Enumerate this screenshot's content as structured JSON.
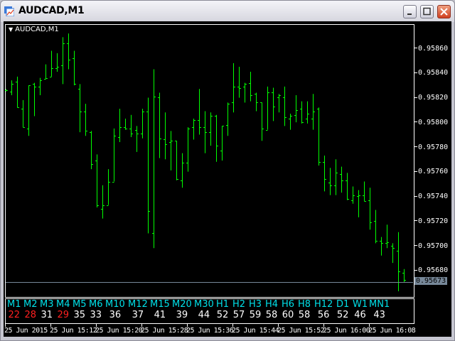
{
  "window": {
    "title": "AUDCAD,M1"
  },
  "chart_label": "AUDCAD,M1",
  "chart_data": {
    "type": "ohlc",
    "symbol": "AUDCAD",
    "timeframe": "M1",
    "ylim": [
      0.9566,
      0.9588
    ],
    "price_labels": [
      "0.95860",
      "0.95840",
      "0.95820",
      "0.95800",
      "0.95780",
      "0.95760",
      "0.95740",
      "0.95720",
      "0.95700",
      "0.95680"
    ],
    "current_price": "0.95673",
    "time_labels": [
      "25 Jun 2015",
      "25 Jun 15:12",
      "25 Jun 15:20",
      "25 Jun 15:28",
      "25 Jun 15:36",
      "25 Jun 15:44",
      "25 Jun 15:52",
      "25 Jun 16:00",
      "25 Jun 16:08"
    ],
    "bar_color": "#00ff00",
    "bars_ohlc": [
      [
        0.95827,
        0.95828,
        0.95826,
        0.95827
      ],
      [
        0.95826,
        0.95835,
        0.95823,
        0.95832
      ],
      [
        0.95834,
        0.95838,
        0.95813,
        0.95813
      ],
      [
        0.95812,
        0.95819,
        0.95797,
        0.95797
      ],
      [
        0.95796,
        0.95831,
        0.9579,
        0.95831
      ],
      [
        0.95832,
        0.95833,
        0.95806,
        0.9583
      ],
      [
        0.9583,
        0.95837,
        0.95823,
        0.95835
      ],
      [
        0.95836,
        0.95848,
        0.95836,
        0.95837
      ],
      [
        0.95838,
        0.95859,
        0.95838,
        0.95845
      ],
      [
        0.95845,
        0.95857,
        0.95842,
        0.95846
      ],
      [
        0.95847,
        0.9587,
        0.95832,
        0.95865
      ],
      [
        0.95865,
        0.95873,
        0.95844,
        0.95852
      ],
      [
        0.95853,
        0.95859,
        0.95831,
        0.95832
      ],
      [
        0.95828,
        0.95832,
        0.95793,
        0.9581
      ],
      [
        0.9581,
        0.95816,
        0.9579,
        0.95794
      ],
      [
        0.95793,
        0.95794,
        0.95763,
        0.95767
      ],
      [
        0.9577,
        0.95775,
        0.95732,
        0.95734
      ],
      [
        0.95731,
        0.9575,
        0.95723,
        0.95734
      ],
      [
        0.95734,
        0.95763,
        0.95734,
        0.95753
      ],
      [
        0.95753,
        0.95796,
        0.95753,
        0.9579
      ],
      [
        0.95789,
        0.95812,
        0.95785,
        0.95797
      ],
      [
        0.95797,
        0.95804,
        0.95795,
        0.95796
      ],
      [
        0.95796,
        0.95807,
        0.95789,
        0.95792
      ],
      [
        0.95795,
        0.95798,
        0.95777,
        0.95792
      ],
      [
        0.95792,
        0.95812,
        0.95788,
        0.9581
      ],
      [
        0.9581,
        0.95821,
        0.95711,
        0.95729
      ],
      [
        0.95711,
        0.95844,
        0.95699,
        0.95822
      ],
      [
        0.95821,
        0.95825,
        0.95772,
        0.95788
      ],
      [
        0.95787,
        0.95809,
        0.95771,
        0.95783
      ],
      [
        0.95785,
        0.95794,
        0.95762,
        0.95786
      ],
      [
        0.95786,
        0.95786,
        0.95754,
        0.95755
      ],
      [
        0.95754,
        0.95776,
        0.95748,
        0.95768
      ],
      [
        0.95768,
        0.95797,
        0.95761,
        0.95796
      ],
      [
        0.95797,
        0.95804,
        0.95787,
        0.95803
      ],
      [
        0.95803,
        0.95828,
        0.95791,
        0.95797
      ],
      [
        0.95797,
        0.9581,
        0.95776,
        0.95793
      ],
      [
        0.95793,
        0.95809,
        0.95782,
        0.95806
      ],
      [
        0.95806,
        0.95807,
        0.95769,
        0.95782
      ],
      [
        0.95778,
        0.95798,
        0.9577,
        0.95798
      ],
      [
        0.95799,
        0.95817,
        0.9579,
        0.95816
      ],
      [
        0.95817,
        0.95849,
        0.95809,
        0.9583
      ],
      [
        0.9583,
        0.95846,
        0.95821,
        0.95829
      ],
      [
        0.9583,
        0.95833,
        0.95817,
        0.95832
      ],
      [
        0.95833,
        0.95842,
        0.95818,
        0.95823
      ],
      [
        0.95824,
        0.95825,
        0.9581,
        0.95817
      ],
      [
        0.95817,
        0.95817,
        0.95786,
        0.95796
      ],
      [
        0.95795,
        0.9583,
        0.95795,
        0.95825
      ],
      [
        0.95825,
        0.95829,
        0.95802,
        0.95814
      ],
      [
        0.95821,
        0.95824,
        0.95809,
        0.95823
      ],
      [
        0.95821,
        0.9583,
        0.95798,
        0.95805
      ],
      [
        0.95804,
        0.95808,
        0.95795,
        0.95806
      ],
      [
        0.95807,
        0.95823,
        0.95801,
        0.95811
      ],
      [
        0.95812,
        0.95818,
        0.958,
        0.95801
      ],
      [
        0.95804,
        0.95818,
        0.958,
        0.95808
      ],
      [
        0.95804,
        0.95824,
        0.95795,
        0.9581
      ],
      [
        0.95812,
        0.95813,
        0.95766,
        0.95769
      ],
      [
        0.95769,
        0.95774,
        0.95745,
        0.95755
      ],
      [
        0.95752,
        0.95764,
        0.95742,
        0.9575
      ],
      [
        0.9575,
        0.95771,
        0.95742,
        0.9576
      ],
      [
        0.95759,
        0.95765,
        0.95744,
        0.95754
      ],
      [
        0.95754,
        0.9576,
        0.95738,
        0.95739
      ],
      [
        0.95738,
        0.95749,
        0.95735,
        0.95742
      ],
      [
        0.95741,
        0.95746,
        0.95724,
        0.95742
      ],
      [
        0.95742,
        0.95753,
        0.95737,
        0.95737
      ],
      [
        0.95738,
        0.95748,
        0.95714,
        0.9572
      ],
      [
        0.95721,
        0.9573,
        0.95703,
        0.95705
      ],
      [
        0.95705,
        0.95708,
        0.95693,
        0.95703
      ],
      [
        0.95703,
        0.95718,
        0.95699,
        0.95704
      ],
      [
        0.95701,
        0.95703,
        0.95687,
        0.95699
      ],
      [
        0.95697,
        0.95712,
        0.95664,
        0.9568
      ],
      [
        0.95679,
        0.95682,
        0.95671,
        0.95673
      ]
    ]
  },
  "indicator": {
    "colors": {
      "label": "#00e0e8",
      "up": "#ffffff",
      "down": "#ff2020"
    },
    "columns": [
      {
        "label": "M1",
        "value": "22",
        "state": "down"
      },
      {
        "label": "M2",
        "value": "28",
        "state": "down"
      },
      {
        "label": "M3",
        "value": "31",
        "state": "up"
      },
      {
        "label": "M4",
        "value": "29",
        "state": "down"
      },
      {
        "label": "M5",
        "value": "35",
        "state": "up"
      },
      {
        "label": "M6",
        "value": "33",
        "state": "up"
      },
      {
        "label": "M10",
        "value": "36",
        "state": "up"
      },
      {
        "label": "M12",
        "value": "37",
        "state": "up"
      },
      {
        "label": "M15",
        "value": "41",
        "state": "up"
      },
      {
        "label": "M20",
        "value": "39",
        "state": "up"
      },
      {
        "label": "M30",
        "value": "44",
        "state": "up"
      },
      {
        "label": "H1",
        "value": "52",
        "state": "up"
      },
      {
        "label": "H2",
        "value": "57",
        "state": "up"
      },
      {
        "label": "H3",
        "value": "59",
        "state": "up"
      },
      {
        "label": "H4",
        "value": "58",
        "state": "up"
      },
      {
        "label": "H6",
        "value": "60",
        "state": "up"
      },
      {
        "label": "H8",
        "value": "58",
        "state": "up"
      },
      {
        "label": "H12",
        "value": "56",
        "state": "up"
      },
      {
        "label": "D1",
        "value": "52",
        "state": "up"
      },
      {
        "label": "W1",
        "value": "46",
        "state": "up"
      },
      {
        "label": "MN1",
        "value": "43",
        "state": "up"
      }
    ]
  }
}
